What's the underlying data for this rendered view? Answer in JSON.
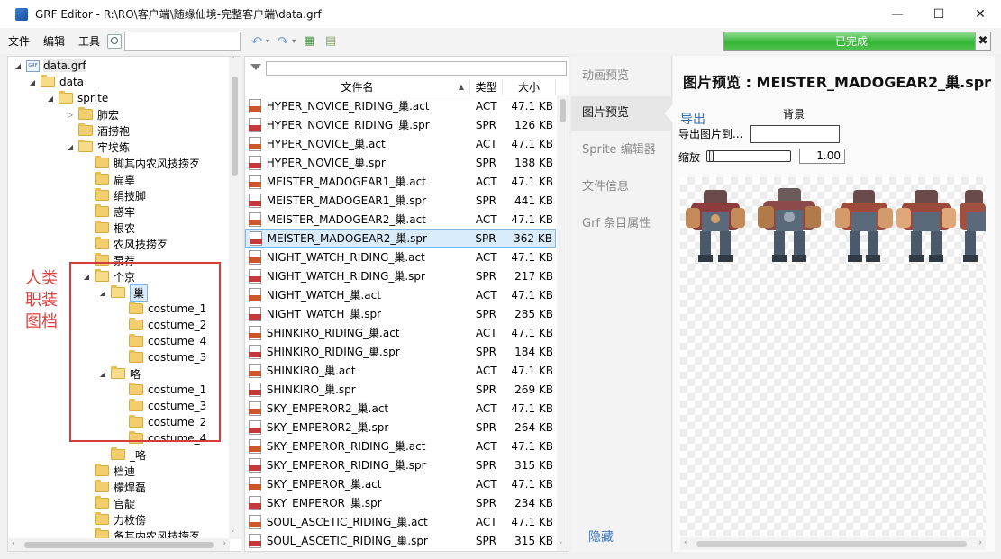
{
  "window": {
    "title": "GRF Editor - R:\\RO\\客户端\\随缘仙境-完整客户端\\data.grf"
  },
  "menu": {
    "file": "文件",
    "edit": "编辑",
    "tools": "工具"
  },
  "search": {
    "value": ""
  },
  "progress": {
    "label": "已完成",
    "fraction": 0.95,
    "color": "#35b535"
  },
  "tree": {
    "root": "data.grf",
    "items": [
      {
        "label": "data",
        "level": 1,
        "arrow": "◢"
      },
      {
        "label": "sprite",
        "level": 2,
        "arrow": "◢"
      },
      {
        "label": "肺宏",
        "level": 3,
        "arrow": "▷"
      },
      {
        "label": "酒捞袍",
        "level": 3,
        "arrow": ""
      },
      {
        "label": "牢埃练",
        "level": 3,
        "arrow": "◢"
      },
      {
        "label": "脚其内农风技捞歹",
        "level": 4,
        "arrow": ""
      },
      {
        "label": "扁辜",
        "level": 4,
        "arrow": ""
      },
      {
        "label": "绢技脚",
        "level": 4,
        "arrow": ""
      },
      {
        "label": "惑牢",
        "level": 4,
        "arrow": ""
      },
      {
        "label": "根农",
        "level": 4,
        "arrow": ""
      },
      {
        "label": "农风技捞歹",
        "level": 4,
        "arrow": ""
      },
      {
        "label": "泵荐",
        "level": 4,
        "arrow": ""
      },
      {
        "label": "个京",
        "level": 4,
        "arrow": "◢"
      },
      {
        "label": "巢",
        "level": 5,
        "arrow": "◢",
        "selected": true
      },
      {
        "label": "costume_1",
        "level": 6,
        "arrow": ""
      },
      {
        "label": "costume_2",
        "level": 6,
        "arrow": ""
      },
      {
        "label": "costume_4",
        "level": 6,
        "arrow": ""
      },
      {
        "label": "costume_3",
        "level": 6,
        "arrow": ""
      },
      {
        "label": "咯",
        "level": 5,
        "arrow": "◢"
      },
      {
        "label": "costume_1",
        "level": 6,
        "arrow": ""
      },
      {
        "label": "costume_3",
        "level": 6,
        "arrow": ""
      },
      {
        "label": "costume_2",
        "level": 6,
        "arrow": ""
      },
      {
        "label": "costume_4",
        "level": 6,
        "arrow": ""
      },
      {
        "label": "_咯",
        "level": 5,
        "arrow": ""
      },
      {
        "label": "档迪",
        "level": 4,
        "arrow": ""
      },
      {
        "label": "檬焊磊",
        "level": 4,
        "arrow": ""
      },
      {
        "label": "官靛",
        "level": 4,
        "arrow": ""
      },
      {
        "label": "力枚傍",
        "level": 4,
        "arrow": ""
      },
      {
        "label": "备其内农风技捞歹",
        "level": 4,
        "arrow": ""
      }
    ]
  },
  "annotation": {
    "text": "人类职装图档",
    "color": "#d93a3a"
  },
  "file_list": {
    "headers": {
      "name": "文件名",
      "type": "类型",
      "size": "大小"
    },
    "rows": [
      {
        "name": "HYPER_NOVICE_RIDING_巢.act",
        "type": "ACT",
        "size": "47.1 KB"
      },
      {
        "name": "HYPER_NOVICE_RIDING_巢.spr",
        "type": "SPR",
        "size": "126 KB"
      },
      {
        "name": "HYPER_NOVICE_巢.act",
        "type": "ACT",
        "size": "47.1 KB"
      },
      {
        "name": "HYPER_NOVICE_巢.spr",
        "type": "SPR",
        "size": "188 KB"
      },
      {
        "name": "MEISTER_MADOGEAR1_巢.act",
        "type": "ACT",
        "size": "47.1 KB"
      },
      {
        "name": "MEISTER_MADOGEAR1_巢.spr",
        "type": "SPR",
        "size": "441 KB"
      },
      {
        "name": "MEISTER_MADOGEAR2_巢.act",
        "type": "ACT",
        "size": "47.1 KB"
      },
      {
        "name": "MEISTER_MADOGEAR2_巢.spr",
        "type": "SPR",
        "size": "362 KB",
        "selected": true
      },
      {
        "name": "NIGHT_WATCH_RIDING_巢.act",
        "type": "ACT",
        "size": "47.1 KB"
      },
      {
        "name": "NIGHT_WATCH_RIDING_巢.spr",
        "type": "SPR",
        "size": "217 KB"
      },
      {
        "name": "NIGHT_WATCH_巢.act",
        "type": "ACT",
        "size": "47.1 KB"
      },
      {
        "name": "NIGHT_WATCH_巢.spr",
        "type": "SPR",
        "size": "285 KB"
      },
      {
        "name": "SHINKIRO_RIDING_巢.act",
        "type": "ACT",
        "size": "47.1 KB"
      },
      {
        "name": "SHINKIRO_RIDING_巢.spr",
        "type": "SPR",
        "size": "184 KB"
      },
      {
        "name": "SHINKIRO_巢.act",
        "type": "ACT",
        "size": "47.1 KB"
      },
      {
        "name": "SHINKIRO_巢.spr",
        "type": "SPR",
        "size": "269 KB"
      },
      {
        "name": "SKY_EMPEROR2_巢.act",
        "type": "ACT",
        "size": "47.1 KB"
      },
      {
        "name": "SKY_EMPEROR2_巢.spr",
        "type": "SPR",
        "size": "264 KB"
      },
      {
        "name": "SKY_EMPEROR_RIDING_巢.act",
        "type": "ACT",
        "size": "47.1 KB"
      },
      {
        "name": "SKY_EMPEROR_RIDING_巢.spr",
        "type": "SPR",
        "size": "315 KB"
      },
      {
        "name": "SKY_EMPEROR_巢.act",
        "type": "ACT",
        "size": "47.1 KB"
      },
      {
        "name": "SKY_EMPEROR_巢.spr",
        "type": "SPR",
        "size": "234 KB"
      },
      {
        "name": "SOUL_ASCETIC_RIDING_巢.act",
        "type": "ACT",
        "size": "47.1 KB"
      },
      {
        "name": "SOUL_ASCETIC_RIDING_巢.spr",
        "type": "SPR",
        "size": "315 KB"
      }
    ]
  },
  "side_tabs": {
    "items": [
      "动画预览",
      "图片预览",
      "Sprite 编辑器",
      "文件信息",
      "Grf 条目属性"
    ],
    "active": 1,
    "hide": "隐藏"
  },
  "preview": {
    "title": "图片预览 : MEISTER_MADOGEAR2_巢.spr",
    "export_link": "导出",
    "background_label": "背景",
    "export_to_label": "导出图片到...",
    "zoom_label": "缩放",
    "zoom_value": "1.00"
  }
}
